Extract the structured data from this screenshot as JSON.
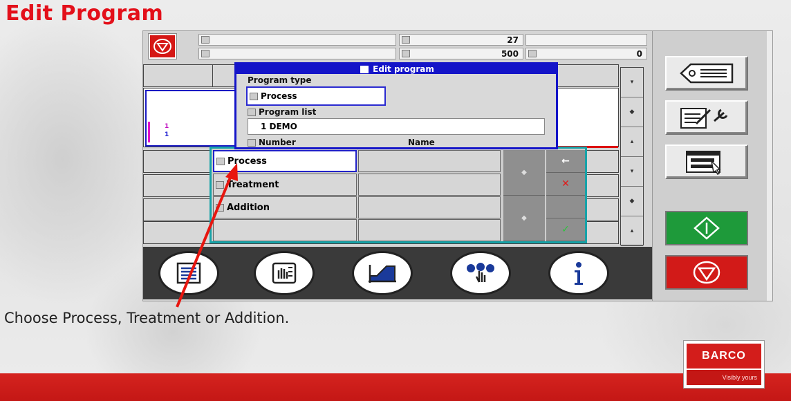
{
  "slide": {
    "title": "Edit Program",
    "caption": "Choose Process, Treatment or Addition."
  },
  "logo": {
    "name": "BARCO",
    "tagline": "Visibly yours"
  },
  "status": {
    "value_1": "27",
    "value_2": "500",
    "value_3": "0"
  },
  "grid": {
    "marker_1": "1",
    "marker_2": "1"
  },
  "dialog": {
    "title": "Edit program",
    "program_type_label": "Program type",
    "program_type_value": "Process",
    "program_list_label": "Program list",
    "program_list_value": "1 DEMO",
    "number_label": "Number",
    "name_label": "Name"
  },
  "selection": {
    "options": [
      "Process",
      "Treatment",
      "Addition"
    ],
    "selected": "Process"
  },
  "colors": {
    "accent_red": "#e3101a",
    "dialog_blue": "#1414c8",
    "panel_teal": "#16a3a8",
    "start_green": "#1e9a3a",
    "stop_red": "#d21a18"
  },
  "icons": {
    "top_right": "tag-icon",
    "edit_tools": "edit-wrench-icon",
    "list_select": "list-pointer-icon",
    "start": "start-diamond-icon",
    "stop": "stop-icon",
    "bottom": [
      "program-list-icon",
      "manual-hand-icon",
      "curve-icon",
      "touch-buttons-icon",
      "info-icon"
    ]
  }
}
